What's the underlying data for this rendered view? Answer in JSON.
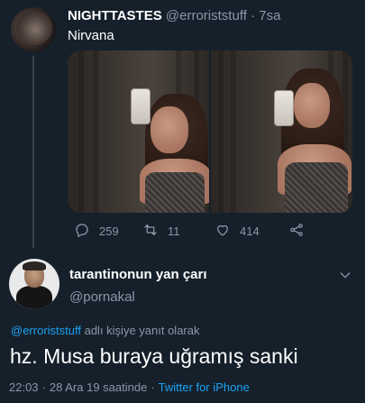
{
  "tweet1": {
    "display_name": "NIGHTTASTES",
    "handle": "@erroriststuff",
    "dot": "·",
    "time": "7sa",
    "text": "Nirvana",
    "counts": {
      "replies": "259",
      "retweets": "11",
      "likes": "414"
    },
    "icons": {
      "reply": "reply-icon",
      "retweet": "retweet-icon",
      "like": "heart-icon",
      "share": "share-icon"
    }
  },
  "tweet2": {
    "display_name": "tarantinonun yan çarı",
    "handle": "@pornakal",
    "reply_to_mention": "@erroriststuff",
    "reply_to_suffix": " adlı kişiye yanıt olarak",
    "text": "hz. Musa buraya uğramış sanki",
    "time": "22:03",
    "date": "28 Ara 19 saatinde",
    "dot": "·",
    "source": "Twitter for iPhone",
    "icons": {
      "more": "chevron-down-icon"
    }
  },
  "colors": {
    "background": "#15202b",
    "muted": "#8899a6",
    "accent": "#1da1f2",
    "divider": "#38444d"
  }
}
